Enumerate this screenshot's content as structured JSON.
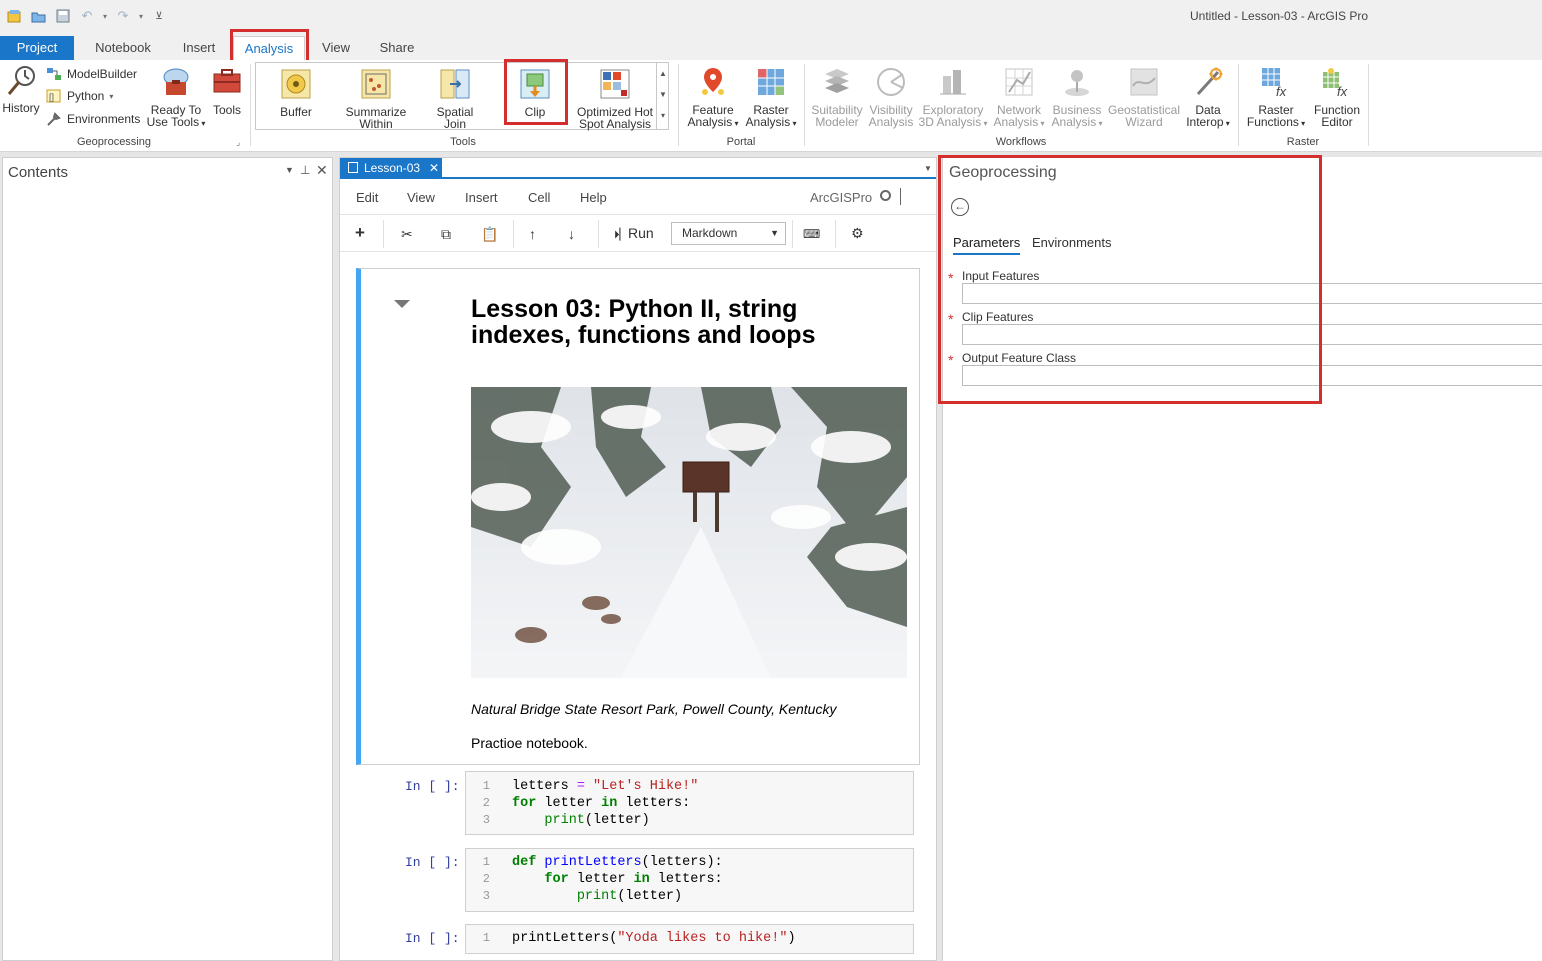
{
  "window": {
    "title": "Untitled - Lesson-03 - ArcGIS Pro"
  },
  "ribbon_tabs": [
    "Project",
    "Notebook",
    "Insert",
    "Analysis",
    "View",
    "Share"
  ],
  "ribbon": {
    "geoprocessing": {
      "history": "History",
      "modelbuilder": "ModelBuilder",
      "python": "Python",
      "environments": "Environments",
      "ready_to_use_1": "Ready To",
      "ready_to_use_2": "Use Tools",
      "tools": "Tools",
      "group": "Geoprocessing"
    },
    "tools": {
      "buffer": "Buffer",
      "summarize_1": "Summarize",
      "summarize_2": "Within",
      "spatial_1": "Spatial",
      "spatial_2": "Join",
      "clip": "Clip",
      "hotspot_1": "Optimized Hot",
      "hotspot_2": "Spot Analysis",
      "group": "Tools"
    },
    "portal": {
      "feature_1": "Feature",
      "feature_2": "Analysis",
      "raster_1": "Raster",
      "raster_2": "Analysis",
      "group": "Portal"
    },
    "workflows": {
      "suit_1": "Suitability",
      "suit_2": "Modeler",
      "vis_1": "Visibility",
      "vis_2": "Analysis",
      "expl_1": "Exploratory",
      "expl_2": "3D Analysis",
      "net_1": "Network",
      "net_2": "Analysis",
      "bus_1": "Business",
      "bus_2": "Analysis",
      "geo_1": "Geostatistical",
      "geo_2": "Wizard",
      "data_1": "Data",
      "data_2": "Interop",
      "group": "Workflows"
    },
    "raster": {
      "rf_1": "Raster",
      "rf_2": "Functions",
      "fe_1": "Function",
      "fe_2": "Editor",
      "group": "Raster"
    }
  },
  "contents": {
    "title": "Contents"
  },
  "notebook": {
    "tab": "Lesson-03",
    "menu": [
      "Edit",
      "View",
      "Insert",
      "Cell",
      "Help"
    ],
    "kernel": "ArcGISPro",
    "run": "Run",
    "cell_type": "Markdown",
    "md_title": "Lesson 03: Python II, string indexes, functions and loops",
    "caption": "Natural Bridge State Resort Park, Powell County, Kentucky",
    "practice": "Practioe notebook.",
    "prompt": "In [ ]:"
  },
  "geoprocessing": {
    "title": "Geoprocessing",
    "tab_params": "Parameters",
    "tab_env": "Environments",
    "input_features": "Input Features",
    "clip_features": "Clip Features",
    "output_fc": "Output Feature Class"
  }
}
